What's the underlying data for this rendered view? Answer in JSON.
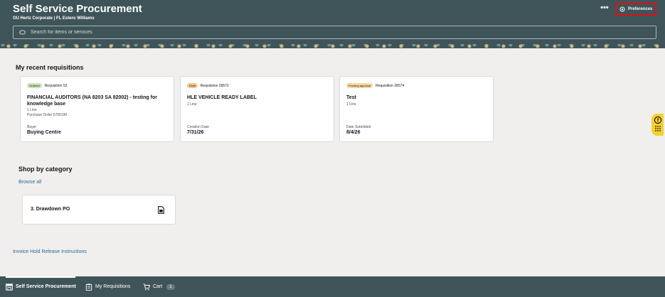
{
  "header": {
    "title": "Self Service Procurement",
    "subtitle": "OU Hertz Corporate | FL Estero Williams",
    "more_label": "•••",
    "preferences_label": "Preferences",
    "search_placeholder": "Search for items or services"
  },
  "recent": {
    "title": "My recent requisitions",
    "cards": [
      {
        "status": "Ordered",
        "number": "Requisition 52",
        "description": "FINANCIAL AUDITORS (NA 8203 SA 82002) - testing for knowledge base",
        "lines": "1 Line",
        "po": "Purchase Order 5700190",
        "label": "Buyer",
        "value": "Buying Centre"
      },
      {
        "status": "Draft",
        "number": "Requisition 28572",
        "description": "HLE VEHICLE READY LABEL",
        "lines": "1 Line",
        "label": "Creation Date",
        "value": "7/31/26"
      },
      {
        "status": "Pending approval",
        "number": "Requisition 28574",
        "description": "Test",
        "lines": "1 Line",
        "label": "Date Submitted",
        "value": "8/4/26"
      }
    ]
  },
  "category": {
    "title": "Shop by category",
    "browse_label": "Browse all",
    "items": [
      {
        "name": "3. Drawdown PO"
      }
    ]
  },
  "footer_link": "Invoice Hold Release Instructions",
  "bottom_nav": {
    "items": [
      {
        "label": "Self Service Procurement",
        "icon": "store-icon",
        "active": true
      },
      {
        "label": "My Requisitions",
        "icon": "clipboard-icon"
      },
      {
        "label": "Cart",
        "icon": "cart-icon"
      }
    ],
    "cart_count": "1"
  },
  "highlight": {
    "target": "preferences-button",
    "color": "#d8121c"
  },
  "colors": {
    "header": "#3f5459",
    "page": "#f1efed",
    "link": "#2b6a94",
    "help": "#f5d02f"
  }
}
